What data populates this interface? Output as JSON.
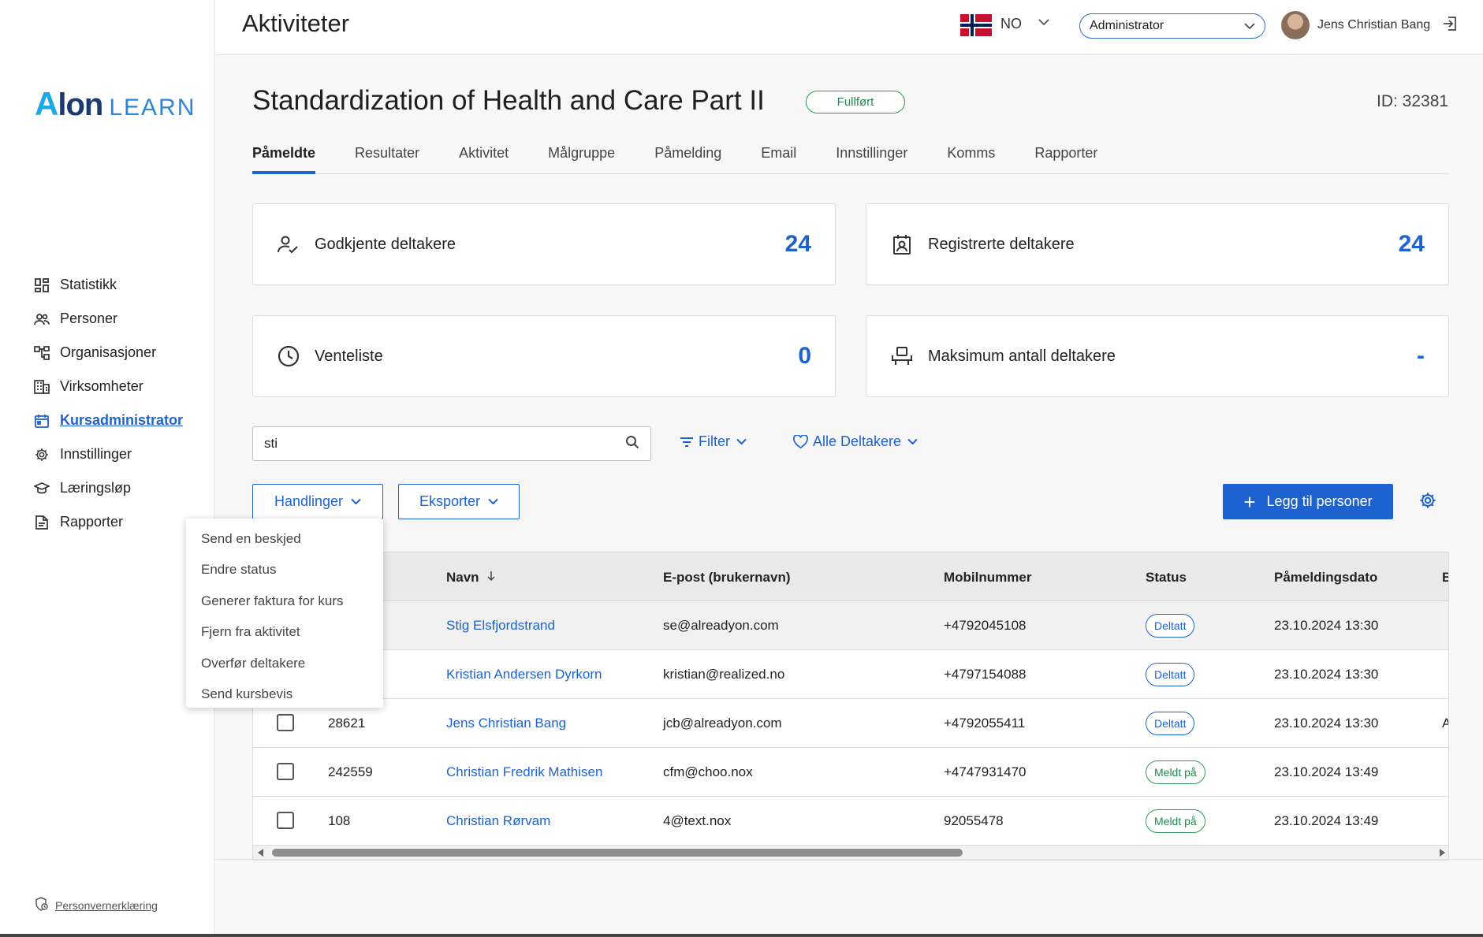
{
  "sidebar": {
    "logo": {
      "a": "A",
      "lon": "lon",
      "learn": "LEARN"
    },
    "items": [
      {
        "label": "Statistikk",
        "icon": "dashboard-icon",
        "active": false
      },
      {
        "label": "Personer",
        "icon": "people-icon",
        "active": false
      },
      {
        "label": "Organisasjoner",
        "icon": "org-chart-icon",
        "active": false
      },
      {
        "label": "Virksomheter",
        "icon": "building-icon",
        "active": false
      },
      {
        "label": "Kursadministrator",
        "icon": "calendar-icon",
        "active": true
      },
      {
        "label": "Innstillinger",
        "icon": "gear-icon",
        "active": false
      },
      {
        "label": "Læringsløp",
        "icon": "graduation-cap-icon",
        "active": false
      },
      {
        "label": "Rapporter",
        "icon": "report-icon",
        "active": false
      }
    ],
    "privacy": "Personvernerklæring"
  },
  "topbar": {
    "title": "Aktiviteter",
    "language": "NO",
    "role": "Administrator",
    "user_name": "Jens Christian Bang"
  },
  "course": {
    "title": "Standardization of Health and Care Part II",
    "status": "Fullført",
    "id": "ID: 32381"
  },
  "tabs": [
    {
      "label": "Påmeldte",
      "active": true
    },
    {
      "label": "Resultater"
    },
    {
      "label": "Aktivitet"
    },
    {
      "label": "Målgruppe"
    },
    {
      "label": "Påmelding"
    },
    {
      "label": "Email"
    },
    {
      "label": "Innstillinger"
    },
    {
      "label": "Komms"
    },
    {
      "label": "Rapporter"
    }
  ],
  "cards": {
    "approved": {
      "label": "Godkjente deltakere",
      "value": "24"
    },
    "registered": {
      "label": "Registrerte deltakere",
      "value": "24"
    },
    "waitlist": {
      "label": "Venteliste",
      "value": "0"
    },
    "max": {
      "label": "Maksimum antall deltakere",
      "value": "-"
    }
  },
  "search": {
    "value": "sti"
  },
  "filter_label": "Filter",
  "participants_filter": "Alle Deltakere",
  "actions_label": "Handlinger",
  "export_label": "Eksporter",
  "add_label": "Legg til personer",
  "table": {
    "headers": {
      "name": "Navn",
      "email": "E-post (brukernavn)",
      "mobile": "Mobilnummer",
      "status": "Status",
      "date": "Påmeldingsdato",
      "extra": "B"
    },
    "rows": [
      {
        "id": "",
        "name": "Stig Elsfjordstrand",
        "email": "se@alreadyon.com",
        "mobile": "+4792045108",
        "status": "Deltatt",
        "date": "23.10.2024 13:30",
        "extra": ""
      },
      {
        "id": "",
        "name": "Kristian Andersen Dyrkorn",
        "email": "kristian@realized.no",
        "mobile": "+4797154088",
        "status": "Deltatt",
        "date": "23.10.2024 13:30",
        "extra": ""
      },
      {
        "id": "28621",
        "name": "Jens Christian Bang",
        "email": "jcb@alreadyon.com",
        "mobile": "+4792055411",
        "status": "Deltatt",
        "date": "23.10.2024 13:30",
        "extra": "A"
      },
      {
        "id": "242559",
        "name": "Christian Fredrik Mathisen",
        "email": "cfm@choo.nox",
        "mobile": "+4747931470",
        "status": "Meldt på",
        "date": "23.10.2024 13:49",
        "extra": ""
      },
      {
        "id": "108",
        "name": "Christian Rørvam",
        "email": "4@text.nox",
        "mobile": "92055478",
        "status": "Meldt på",
        "date": "23.10.2024 13:49",
        "extra": ""
      }
    ]
  },
  "actions_menu": [
    "Send en beskjed",
    "Endre status",
    "Generer faktura for kurs",
    "Fjern fra aktivitet",
    "Overfør deltakere",
    "Send kursbevis"
  ],
  "colors": {
    "accent": "#1e62d0",
    "success": "#1f8a4c"
  }
}
